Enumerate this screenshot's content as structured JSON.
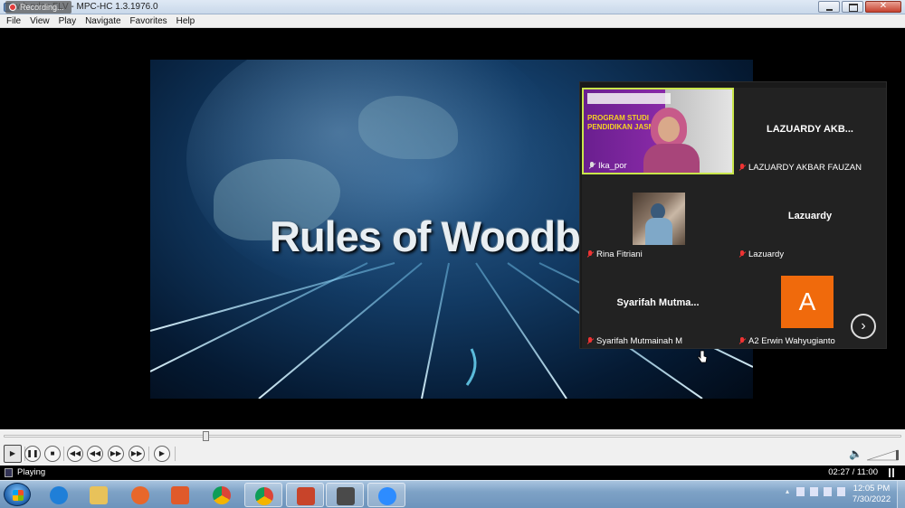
{
  "window": {
    "title": "wb rules.FLV - MPC-HC 1.3.1976.0",
    "recording_label": "Recording..."
  },
  "menu": [
    "File",
    "View",
    "Play",
    "Navigate",
    "Favorites",
    "Help"
  ],
  "video": {
    "title_text": "Rules of Woodb"
  },
  "zoom": {
    "participants": [
      {
        "label": "Ika_por",
        "display": "",
        "type": "video",
        "active": true,
        "muted": false
      },
      {
        "label": "LAZUARDY AKBAR FAUZAN",
        "display": "LAZUARDY AKB...",
        "type": "name",
        "active": false,
        "muted": true
      },
      {
        "label": "Rina Fitriani",
        "display": "",
        "type": "photo",
        "active": false,
        "muted": true
      },
      {
        "label": "Lazuardy",
        "display": "Lazuardy",
        "type": "name",
        "active": false,
        "muted": true
      },
      {
        "label": "Syarifah Mutmainah M",
        "display": "Syarifah  Mutma...",
        "type": "name",
        "active": false,
        "muted": true
      },
      {
        "label": "A2 Erwin Wahyugianto",
        "display": "A",
        "type": "avatar",
        "active": false,
        "muted": true
      }
    ],
    "slide_text_line1": "PROGRAM STUDI",
    "slide_text_line2": "PENDIDIKAN JASM",
    "next_icon": "chevron-right-icon"
  },
  "playback": {
    "progress_fraction": 0.2247,
    "status": "Playing",
    "time": "02:27 / 11:00",
    "controls": [
      "play-icon",
      "pause-icon",
      "stop-icon",
      "skip-back-icon",
      "rewind-icon",
      "forward-icon",
      "skip-forward-icon",
      "frame-step-icon"
    ]
  },
  "taskbar": {
    "clock_time": "12:05 PM",
    "clock_date": "7/30/2022",
    "apps": [
      {
        "name": "internet-explorer-icon",
        "color": "#1f7fd8",
        "open": false
      },
      {
        "name": "file-explorer-icon",
        "color": "#e8c25a",
        "open": false
      },
      {
        "name": "firefox-icon",
        "color": "#e8672a",
        "open": false
      },
      {
        "name": "media-player-icon",
        "color": "#e05a2a",
        "open": false
      },
      {
        "name": "chrome-icon",
        "color": "#3a9b45",
        "open": false
      },
      {
        "name": "chrome-profile-icon",
        "color": "#d94535",
        "open": true
      },
      {
        "name": "powerpoint-icon",
        "color": "#c8442a",
        "open": true
      },
      {
        "name": "mpc-hc-icon",
        "color": "#4a4a4a",
        "open": true
      },
      {
        "name": "zoom-icon",
        "color": "#2d8cff",
        "open": true
      }
    ]
  }
}
